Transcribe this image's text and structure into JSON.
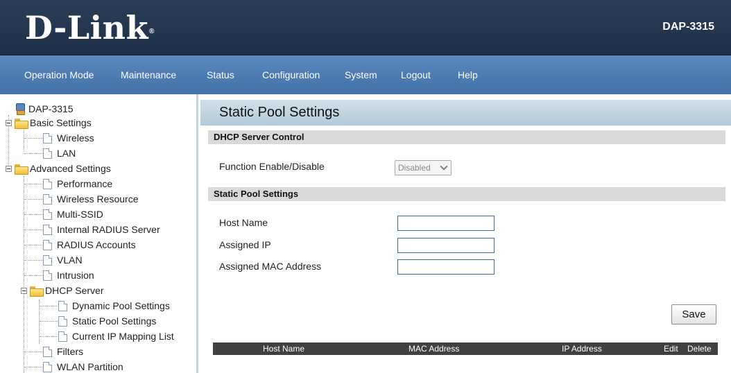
{
  "header": {
    "logo_text": "D-Link",
    "logo_mark": "®",
    "model": "DAP-3315"
  },
  "nav": {
    "items": [
      "Operation Mode",
      "Maintenance",
      "Status",
      "Configuration",
      "System",
      "Logout",
      "Help"
    ]
  },
  "tree": {
    "root": "DAP-3315",
    "basic_settings": "Basic Settings",
    "wireless": "Wireless",
    "lan": "LAN",
    "advanced_settings": "Advanced Settings",
    "performance": "Performance",
    "wireless_resource": "Wireless Resource",
    "multi_ssid": "Multi-SSID",
    "internal_radius": "Internal RADIUS Server",
    "radius_accounts": "RADIUS Accounts",
    "vlan": "VLAN",
    "intrusion": "Intrusion",
    "dhcp_server": "DHCP Server",
    "dynamic_pool": "Dynamic Pool Settings",
    "static_pool": "Static Pool Settings",
    "current_ip": "Current IP Mapping List",
    "filters": "Filters",
    "wlan_partition": "WLAN Partition"
  },
  "main": {
    "page_title": "Static Pool Settings",
    "dhcp_control_title": "DHCP Server Control",
    "function_label": "Function Enable/Disable",
    "function_value": "Disabled",
    "static_pool_title": "Static Pool Settings",
    "host_name_label": "Host Name",
    "assigned_ip_label": "Assigned IP",
    "assigned_mac_label": "Assigned MAC Address",
    "host_name_value": "",
    "assigned_ip_value": "",
    "assigned_mac_value": "",
    "save_label": "Save",
    "table_headers": [
      "Host Name",
      "MAC Address",
      "IP Address",
      "Edit",
      "Delete"
    ]
  }
}
